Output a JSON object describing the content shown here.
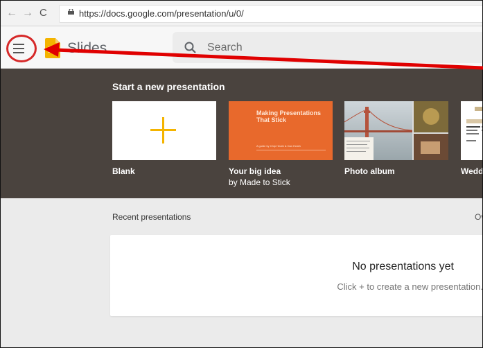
{
  "browser": {
    "back_icon": "←",
    "forward_icon": "→",
    "reload_icon": "C",
    "url": "https://docs.google.com/presentation/u/0/"
  },
  "app": {
    "name": "Slides",
    "search_placeholder": "Search"
  },
  "gallery": {
    "title": "Start a new presentation",
    "templates": [
      {
        "label": "Blank",
        "sublabel": ""
      },
      {
        "label": "Your big idea",
        "sublabel": "by Made to Stick",
        "thumb_title": "Making Presentations That Stick",
        "thumb_caption": "A guide by Chip Heath & Dan Heath"
      },
      {
        "label": "Photo album",
        "sublabel": ""
      },
      {
        "label": "Wedd",
        "sublabel": ""
      }
    ]
  },
  "recent": {
    "title": "Recent presentations",
    "owner_filter": "Ov",
    "empty_title": "No presentations yet",
    "empty_hint": "Click + to create a new presentation."
  },
  "colors": {
    "gallery_bg": "#4a433e",
    "accent_orange": "#e8692c",
    "plus_yellow": "#f4b400",
    "annotation_red": "#e00000"
  }
}
